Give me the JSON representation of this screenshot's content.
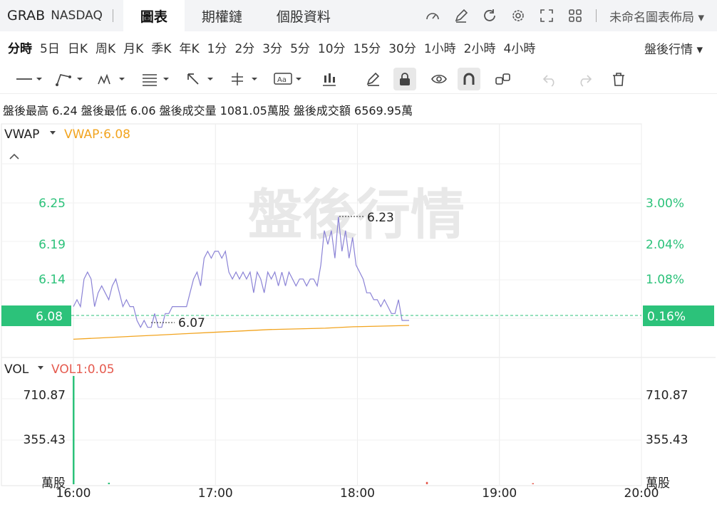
{
  "header": {
    "symbol": "GRAB",
    "exchange": "NASDAQ",
    "tabs": [
      "圖表",
      "期權鏈",
      "個股資料"
    ],
    "layout": "未命名圖表佈局"
  },
  "periods": [
    "分時",
    "5日",
    "日K",
    "周K",
    "月K",
    "季K",
    "年K",
    "1分",
    "2分",
    "3分",
    "5分",
    "10分",
    "15分",
    "30分",
    "1小時",
    "2小時",
    "4小時"
  ],
  "session": "盤後行情",
  "stats": "盤後最高 6.24 盤後最低 6.06 盤後成交量 1081.05萬股 盤後成交額 6569.95萬",
  "main": {
    "indicator": "VWAP",
    "indicator_value": "VWAP:6.08",
    "watermark": "盤後行情",
    "high_label": "6.23",
    "low_label": "6.07",
    "current_price": "6.08",
    "current_pct": "0.16%"
  },
  "vol": {
    "indicator": "VOL",
    "indicator_value": "VOL1:0.05",
    "unit_left": "萬股",
    "unit_right": "萬股"
  },
  "colors": {
    "up": "#2cc27a",
    "down": "#e55a4e",
    "price_line": "#8b83d6",
    "vwap": "#f2a41f"
  },
  "chart_data": [
    {
      "type": "line",
      "x_ticks": [
        "16:00",
        "17:00",
        "18:00",
        "19:00",
        "20:00"
      ],
      "y_ticks_left": [
        "6.25",
        "6.19",
        "6.14"
      ],
      "y_ticks_right": [
        "3.00%",
        "2.04%",
        "1.08%"
      ],
      "series": [
        {
          "values": [
            6.1,
            6.11,
            6.1,
            6.14,
            6.15,
            6.14,
            6.1,
            6.12,
            6.13,
            6.12,
            6.11,
            6.13,
            6.14,
            6.12,
            6.1,
            6.11,
            6.1,
            6.1,
            6.08,
            6.07,
            6.08,
            6.07,
            6.07,
            6.09,
            6.07,
            6.07,
            6.09,
            6.09,
            6.1,
            6.1,
            6.1,
            6.1,
            6.1,
            6.12,
            6.14,
            6.15,
            6.13,
            6.17,
            6.18,
            6.17,
            6.18,
            6.18,
            6.17,
            6.18,
            6.15,
            6.14,
            6.15,
            6.14,
            6.15,
            6.14,
            6.15,
            6.12,
            6.15,
            6.14,
            6.12,
            6.15,
            6.14,
            6.15,
            6.13,
            6.15,
            6.13,
            6.15,
            6.14,
            6.13,
            6.14,
            6.14,
            6.13,
            6.14,
            6.14,
            6.13,
            6.16,
            6.21,
            6.19,
            6.21,
            6.17,
            6.23,
            6.18,
            6.21,
            6.17,
            6.2,
            6.16,
            6.15,
            6.14,
            6.12,
            6.12,
            6.11,
            6.11,
            6.1,
            6.11,
            6.1,
            6.09,
            6.09,
            6.11,
            6.08,
            6.08,
            6.08
          ]
        },
        {
          "name": "VWAP",
          "values": [
            6.06,
            6.062,
            6.064,
            6.066,
            6.068,
            6.07,
            6.072,
            6.074,
            6.075,
            6.076,
            6.078,
            6.079,
            6.08
          ]
        }
      ],
      "ylim": [
        6.03,
        6.3
      ]
    },
    {
      "type": "bar",
      "y_ticks": [
        "710.87",
        "355.43"
      ],
      "ylim": [
        0,
        860
      ],
      "values": [
        [
          0,
          860,
          "up"
        ],
        [
          10,
          12,
          "up"
        ],
        [
          100,
          18,
          "down"
        ],
        [
          130,
          8,
          "down"
        ]
      ]
    }
  ]
}
